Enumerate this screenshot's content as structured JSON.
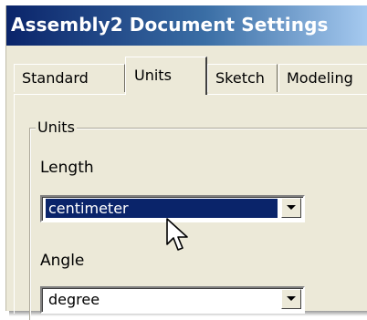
{
  "window": {
    "title": "Assembly2 Document Settings"
  },
  "tabs": [
    {
      "label": "Standard"
    },
    {
      "label": "Units"
    },
    {
      "label": "Sketch"
    },
    {
      "label": "Modeling"
    }
  ],
  "units_group": {
    "legend": "Units",
    "length": {
      "label": "Length",
      "value": "centimeter"
    },
    "angle": {
      "label": "Angle",
      "value": "degree"
    }
  },
  "icons": {
    "dropdown": "chevron-down-icon",
    "cursor": "mouse-pointer-icon"
  },
  "colors": {
    "titlebar_start": "#0a246a",
    "titlebar_end": "#a6caf0",
    "selection": "#0a246a",
    "dialog_face": "#ece9d8"
  }
}
